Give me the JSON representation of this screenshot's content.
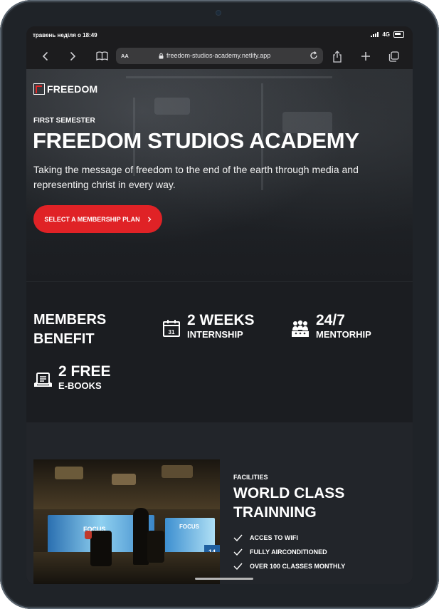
{
  "status_bar": {
    "time": "травень неділя о 18:49",
    "network": "4G"
  },
  "browser": {
    "aa_label": "AA",
    "url": "freedom-studios-academy.netlify.app",
    "icons": [
      "chevron-left-icon",
      "chevron-right-icon",
      "book-icon",
      "lock-icon",
      "reload-icon",
      "share-icon",
      "plus-icon",
      "tabs-icon"
    ]
  },
  "hero": {
    "logo_text": "FREEDOM",
    "eyebrow": "FIRST SEMESTER",
    "title": "FREEDOM STUDIOS ACADEMY",
    "subtitle": "Taking the message of freedom to the end of the earth through media and representing christ in every way.",
    "cta_label": "SELECT A MEMBERSHIP PLAN",
    "accent_color": "#e02226"
  },
  "benefits": {
    "heading_line1": "MEMBERS",
    "heading_line2": "BENEFIT",
    "items": [
      {
        "big": "2 WEEKS",
        "small": "INTERNSHIP",
        "icon": "calendar-icon",
        "icon_text": "31"
      },
      {
        "big": "24/7",
        "small": "MENTORHIP",
        "icon": "people-icon"
      },
      {
        "big": "2 FREE",
        "small": "E-BOOKS",
        "icon": "ebook-icon"
      }
    ]
  },
  "facilities": {
    "eyebrow": "FACILITIES",
    "title": "WORLD CLASS TRAINNING",
    "features": [
      "ACCES TO WIFI",
      "FULLY AIRCONDITIONED",
      "OVER 100 CLASSES MONTHLY"
    ],
    "photo_text": [
      "FOCUS",
      "FOCUS",
      "14"
    ]
  }
}
